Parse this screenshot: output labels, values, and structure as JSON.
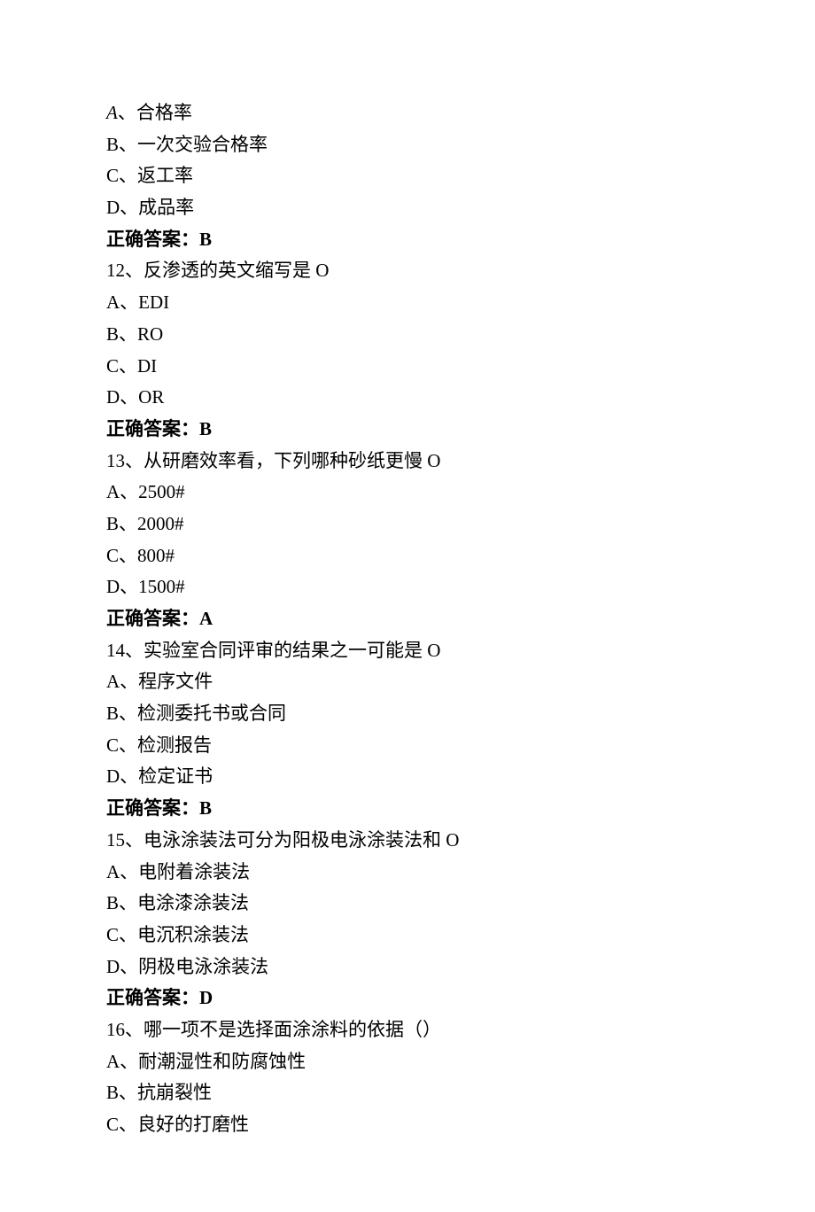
{
  "q11": {
    "opt_a_prefix": "A",
    "opt_a": "、合格率",
    "opt_b": "B、一次交验合格率",
    "opt_c": "C、返工率",
    "opt_d": "D、成品率",
    "answer": "正确答案：B"
  },
  "q12": {
    "stem": "12、反渗透的英文缩写是 O",
    "opt_a": "A、EDI",
    "opt_b": "B、RO",
    "opt_c": "C、DI",
    "opt_d": "D、OR",
    "answer": "正确答案：B"
  },
  "q13": {
    "stem": "13、从研磨效率看，下列哪种砂纸更慢 O",
    "opt_a": "A、2500#",
    "opt_b": "B、2000#",
    "opt_c": "C、800#",
    "opt_d": "D、1500#",
    "answer": "正确答案：A"
  },
  "q14": {
    "stem": "14、实验室合同评审的结果之一可能是 O",
    "opt_a": "A、程序文件",
    "opt_b": "B、检测委托书或合同",
    "opt_c": "C、检测报告",
    "opt_d": "D、检定证书",
    "answer": "正确答案：B"
  },
  "q15": {
    "stem": "15、电泳涂装法可分为阳极电泳涂装法和 O",
    "opt_a": "A、电附着涂装法",
    "opt_b": "B、电涂漆涂装法",
    "opt_c": "C、电沉积涂装法",
    "opt_d": "D、阴极电泳涂装法",
    "answer": "正确答案：D"
  },
  "q16": {
    "stem": "16、哪一项不是选择面涂涂料的依据（）",
    "opt_a": "A、耐潮湿性和防腐蚀性",
    "opt_b": "B、抗崩裂性",
    "opt_c": "C、良好的打磨性"
  }
}
